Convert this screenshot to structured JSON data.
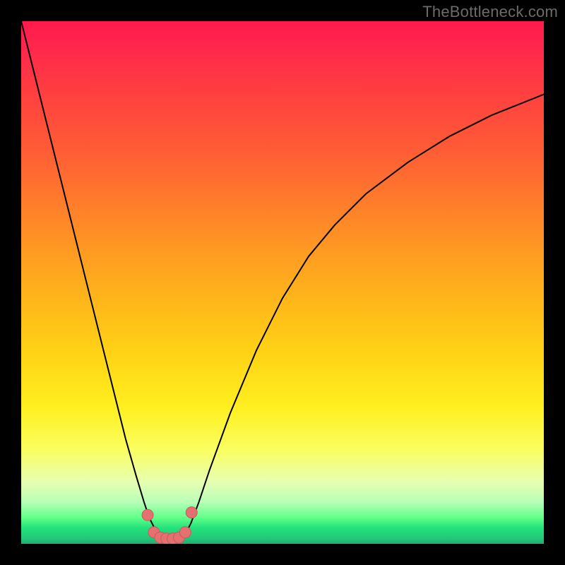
{
  "watermark": "TheBottleneck.com",
  "colors": {
    "page_bg": "#000000",
    "curve_stroke": "#000000",
    "marker_fill": "#e4716f",
    "marker_stroke": "#c85a58"
  },
  "chart_data": {
    "type": "line",
    "title": "",
    "xlabel": "",
    "ylabel": "",
    "xlim": [
      0,
      100
    ],
    "ylim": [
      0,
      100
    ],
    "grid": false,
    "legend": false,
    "series": [
      {
        "name": "left-branch",
        "x": [
          0,
          3,
          6,
          9,
          12,
          15,
          18,
          20,
          22,
          23.5,
          24.5,
          25.5,
          26.5,
          27.5,
          28.5,
          29.5,
          30.5
        ],
        "y": [
          100,
          88,
          76,
          64,
          52,
          40,
          28,
          20,
          13,
          8,
          5,
          3,
          1.5,
          1,
          1,
          1,
          1
        ]
      },
      {
        "name": "right-branch",
        "x": [
          30.5,
          31.5,
          32.5,
          34,
          36,
          40,
          45,
          50,
          55,
          60,
          66,
          74,
          82,
          90,
          100
        ],
        "y": [
          1,
          2,
          4,
          8,
          14,
          25,
          37,
          47,
          55,
          61,
          67,
          73,
          78,
          82,
          86
        ]
      }
    ],
    "markers": {
      "x": [
        24.2,
        25.4,
        26.6,
        27.8,
        29.0,
        30.2,
        31.4,
        32.6
      ],
      "y": [
        5.5,
        2.2,
        1.2,
        1.0,
        1.0,
        1.2,
        2.2,
        6.0
      ]
    },
    "gradient_stops": [
      {
        "pos": 0.0,
        "color": "#ff1a4d"
      },
      {
        "pos": 0.34,
        "color": "#ff7a2c"
      },
      {
        "pos": 0.74,
        "color": "#fff020"
      },
      {
        "pos": 0.92,
        "color": "#b8ffb8"
      },
      {
        "pos": 1.0,
        "color": "#1fae70"
      }
    ]
  }
}
